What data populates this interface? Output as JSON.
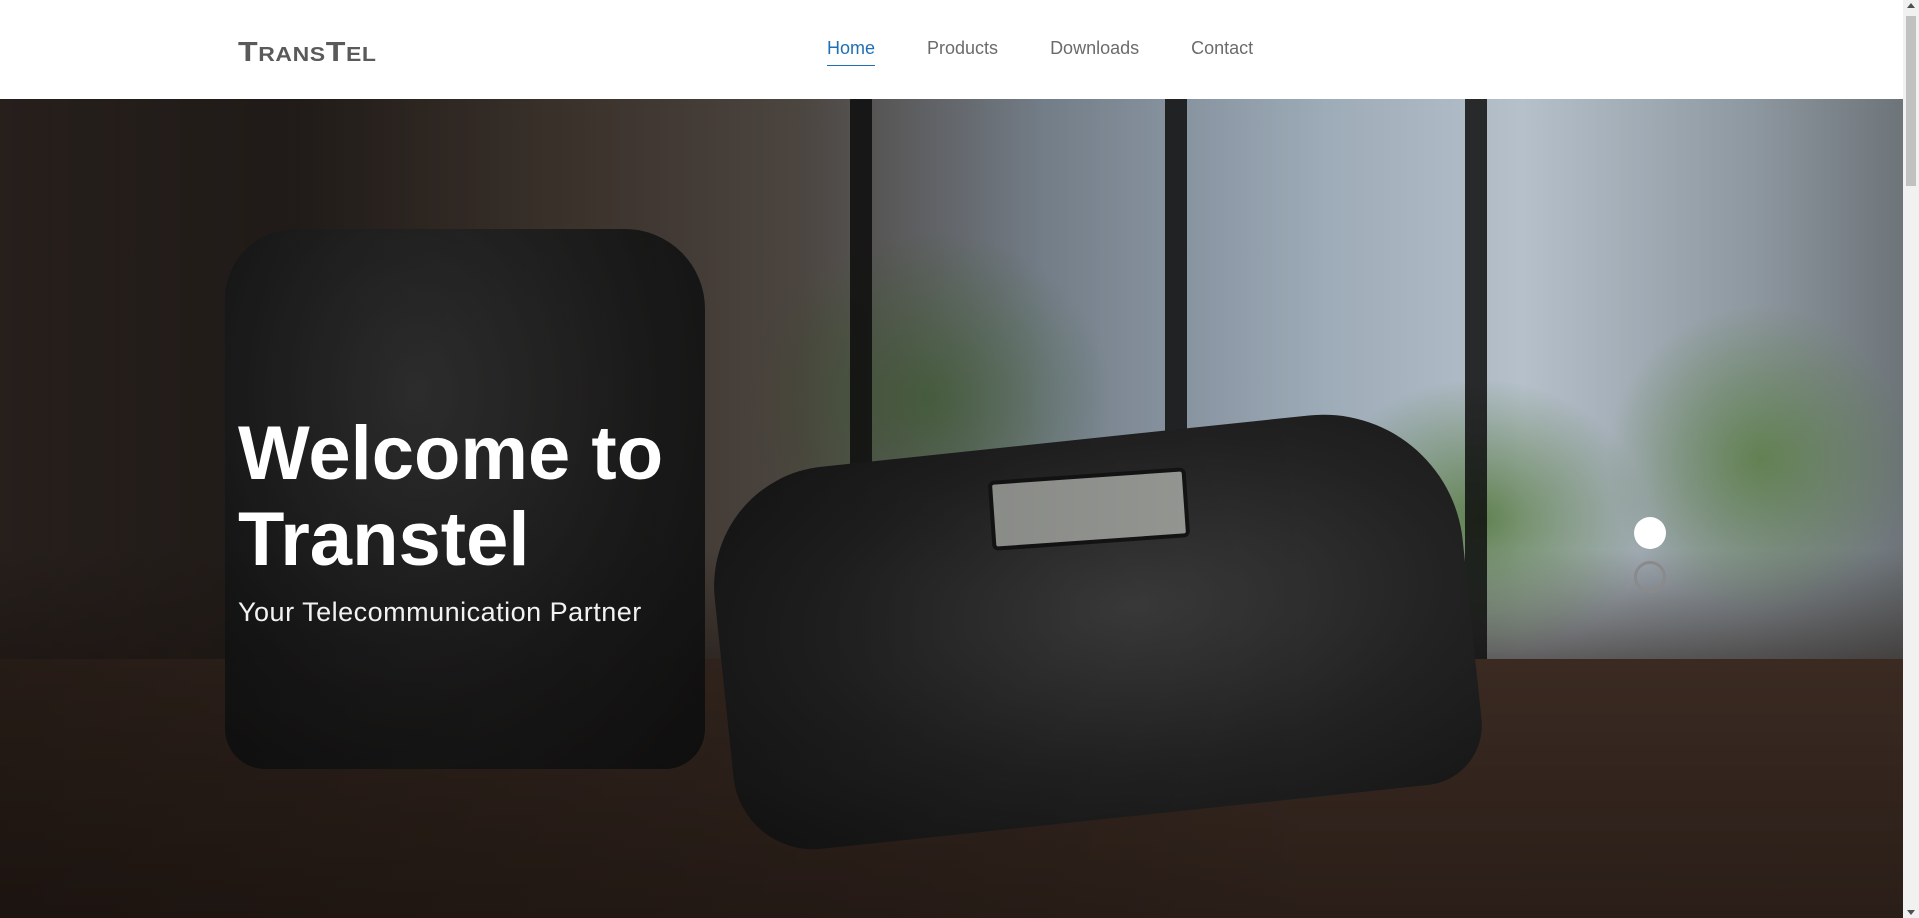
{
  "header": {
    "logo_text": "TransTel",
    "nav": [
      {
        "label": "Home",
        "active": true
      },
      {
        "label": "Products",
        "active": false
      },
      {
        "label": "Downloads",
        "active": false
      },
      {
        "label": "Contact",
        "active": false
      }
    ]
  },
  "hero": {
    "title": "Welcome to Transtel",
    "subtitle": "Your Telecommunication Partner",
    "background_image": "office desk telephone with plants and city window",
    "slides": [
      {
        "active": true
      },
      {
        "active": false
      }
    ]
  },
  "colors": {
    "nav_active": "#1f6fb5",
    "nav_text": "#6b6b6b",
    "logo": "#5a5a5a",
    "hero_text": "#ffffff"
  },
  "scrollbar": {
    "up_icon": "triangle-up-icon",
    "down_icon": "triangle-down-icon"
  }
}
